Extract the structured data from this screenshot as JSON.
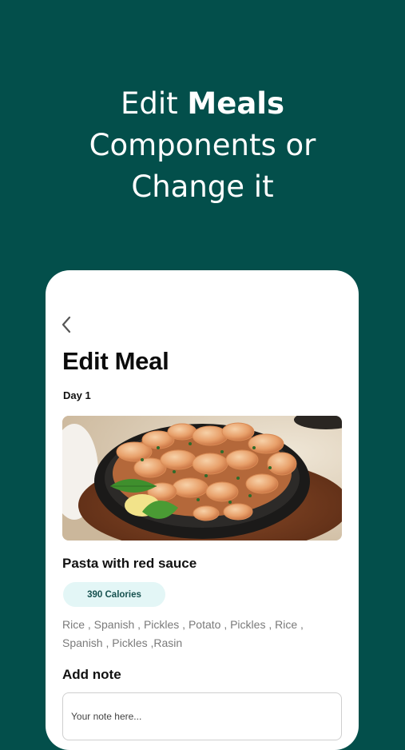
{
  "promo": {
    "line1_prefix": "Edit ",
    "line1_bold": "Meals",
    "line2": "Components or",
    "line3": "Change it"
  },
  "screen": {
    "title": "Edit Meal",
    "day": "Day 1",
    "back_icon": "chevron-left-icon",
    "meal": {
      "name": "Pasta with red sauce",
      "calories": "390 Calories",
      "ingredients": "Rice , Spanish , Pickles , Potato , Pickles , Rice , Spanish , Pickles ,Rasin"
    },
    "note": {
      "label": "Add note",
      "placeholder": "Your note here..."
    }
  },
  "colors": {
    "background": "#034f4b",
    "card": "#ffffff",
    "badge_bg": "#e3f6f6",
    "badge_text": "#16514f"
  }
}
